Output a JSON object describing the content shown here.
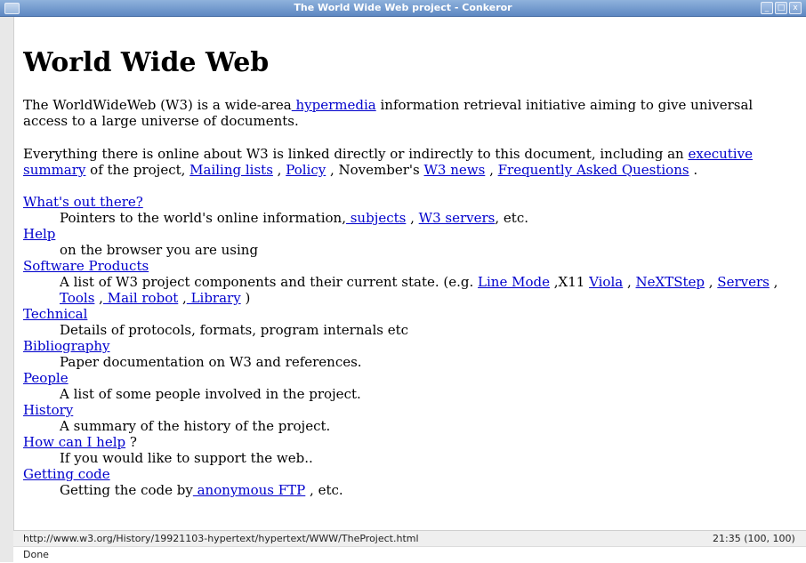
{
  "window": {
    "title": "The World Wide Web project - Conkeror",
    "minimize_glyph": "_",
    "maximize_glyph": "□",
    "close_glyph": "x"
  },
  "page": {
    "heading": "World Wide Web",
    "intro": {
      "before": "The WorldWideWeb (W3) is a wide-area",
      "link": " hypermedia",
      "after": " information retrieval initiative aiming to give universal access to a large universe of documents."
    },
    "everything": {
      "before": "Everything there is online about W3 is linked directly or indirectly to this document, including an ",
      "link_summary": "executive summary",
      "mid1": " of the project, ",
      "link_mailing": "Mailing lists",
      "sep1": " , ",
      "link_policy": "Policy",
      "mid2": " , November's ",
      "link_news": "W3 news",
      "sep2": " , ",
      "link_faq": "Frequently Asked Questions",
      "end": " ."
    },
    "entries": {
      "whats_out": {
        "term": "What's out there?",
        "desc_before": "Pointers to the world's online information,",
        "link_subjects": " subjects",
        "sep": " , ",
        "link_servers": "W3 servers",
        "desc_after": ", etc."
      },
      "help": {
        "term": "Help",
        "desc": "on the browser you are using"
      },
      "software": {
        "term": "Software Products",
        "desc_before": "A list of W3 project components and their current state. (e.g. ",
        "link_linemode": "Line Mode",
        "mid1": " ,X11 ",
        "link_viola": "Viola",
        "sep1": " , ",
        "link_nextstep": "NeXTStep",
        "sep2": " , ",
        "link_servers": "Servers",
        "sep3": " ,",
        "link_tools": "Tools",
        "sep4": " ,",
        "link_mailrobot": " Mail robot",
        "sep5": " ,",
        "link_library": " Library",
        "end": " )"
      },
      "technical": {
        "term": "Technical",
        "desc": "Details of protocols, formats, program internals etc"
      },
      "bibliography": {
        "term": "Bibliography",
        "desc": "Paper documentation on W3 and references."
      },
      "people": {
        "term": "People",
        "desc": "A list of some people involved in the project."
      },
      "history": {
        "term": "History",
        "desc": "A summary of the history of the project."
      },
      "howcanihelp": {
        "term": "How can I help",
        "term_after": " ?",
        "desc": "If you would like to support the web.."
      },
      "gettingcode": {
        "term": "Getting code",
        "desc_before": "Getting the code by",
        "link_ftp": " anonymous FTP",
        "desc_after": " , etc."
      }
    }
  },
  "statusbar": {
    "url": "http://www.w3.org/History/19921103-hypertext/hypertext/WWW/TheProject.html",
    "clock_position": "21:35  (100, 100)"
  },
  "minibuffer": {
    "text": "Done"
  }
}
